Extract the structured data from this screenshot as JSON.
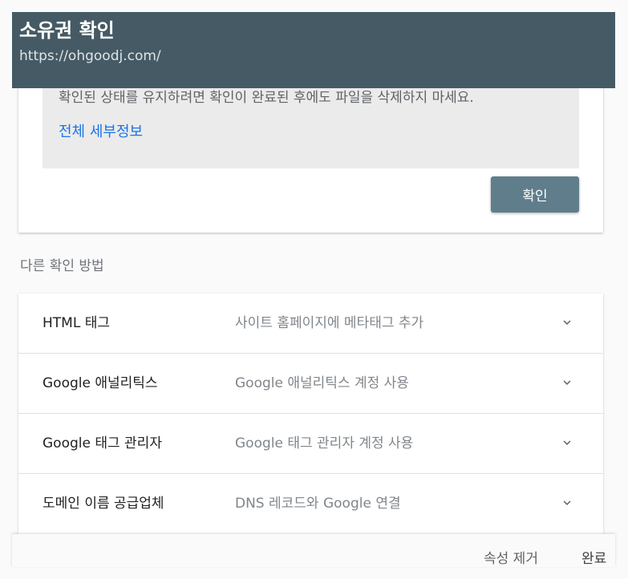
{
  "header": {
    "title": "소유권 확인",
    "url": "https://ohgoodj.com/"
  },
  "info": {
    "text": "확인된 상태를 유지하려면 확인이 완료된 후에도 파일을 삭제하지 마세요.",
    "link": "전체 세부정보"
  },
  "verify_button": "확인",
  "other_methods_label": "다른 확인 방법",
  "methods": [
    {
      "name": "HTML 태그",
      "description": "사이트 홈페이지에 메타태그 추가"
    },
    {
      "name": "Google 애널리틱스",
      "description": "Google 애널리틱스 계정 사용"
    },
    {
      "name": "Google 태그 관리자",
      "description": "Google 태그 관리자 계정 사용"
    },
    {
      "name": "도메인 이름 공급업체",
      "description": "DNS 레코드와 Google 연결"
    }
  ],
  "footer": {
    "remove": "속성 제거",
    "done": "완료"
  },
  "colors": {
    "header_bg": "#455a64",
    "button_bg": "#607d8b",
    "link": "#1a73e8"
  }
}
